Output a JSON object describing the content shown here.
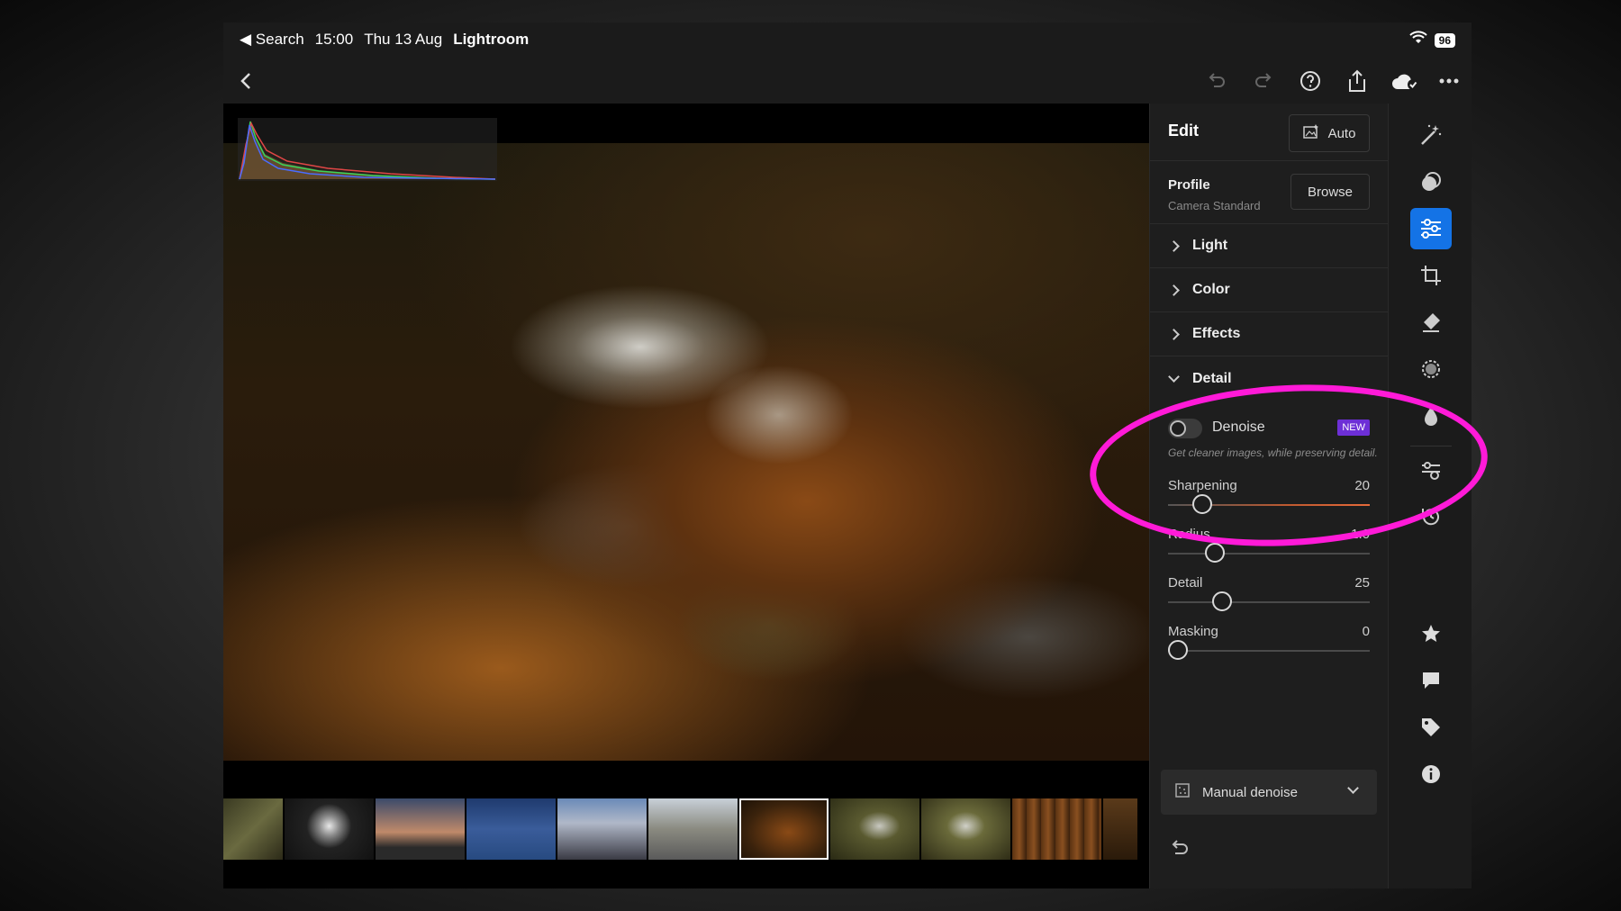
{
  "statusbar": {
    "back_app": "◀ Search",
    "time": "15:00",
    "date": "Thu 13 Aug",
    "app_name": "Lightroom",
    "battery": "96"
  },
  "panel": {
    "title": "Edit",
    "auto_label": "Auto",
    "profile_label": "Profile",
    "profile_value": "Camera Standard",
    "browse_label": "Browse",
    "sections": {
      "light": "Light",
      "color": "Color",
      "effects": "Effects",
      "detail": "Detail"
    },
    "denoise": {
      "label": "Denoise",
      "badge": "NEW",
      "hint": "Get cleaner images, while preserving detail.",
      "enabled": false
    },
    "sliders": {
      "sharpening": {
        "label": "Sharpening",
        "value": "20",
        "fraction": 0.17
      },
      "radius": {
        "label": "Radius",
        "value": "1.0",
        "fraction": 0.23
      },
      "detail": {
        "label": "Detail",
        "value": "25",
        "fraction": 0.27
      },
      "masking": {
        "label": "Masking",
        "value": "0",
        "fraction": 0.0
      }
    },
    "dropdown": {
      "label": "Manual denoise"
    }
  },
  "filmstrip": {
    "count": 11,
    "selected_index": 6
  },
  "icons": {
    "toolbar": [
      "back-chevron-icon",
      "undo-icon",
      "redo-icon",
      "help-icon",
      "share-icon",
      "cloud-sync-icon",
      "more-icon"
    ],
    "toolstrip": [
      "magic-wand-icon",
      "presets-icon",
      "edit-sliders-icon",
      "crop-icon",
      "healing-eraser-icon",
      "masking-icon",
      "blur-icon",
      "versions-icon",
      "history-icon",
      "star-icon",
      "comment-icon",
      "tag-icon",
      "info-icon"
    ]
  },
  "colors": {
    "accent": "#1473e6",
    "annotation": "#ff1ad8",
    "badge": "#6d2fd6"
  }
}
